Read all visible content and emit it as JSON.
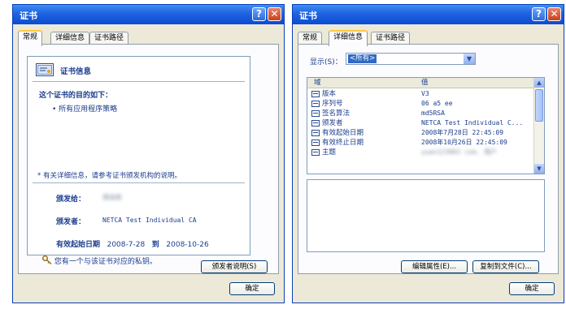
{
  "left_dialog": {
    "title": "证书",
    "help_label": "?",
    "close_label": "✕",
    "tabs": [
      {
        "label": "常规"
      },
      {
        "label": "详细信息"
      },
      {
        "label": "证书路径"
      }
    ],
    "header": {
      "title": "证书信息"
    },
    "purpose_title": "这个证书的目的如下：",
    "purpose_items": [
      "• 所有应用程序策略"
    ],
    "more_info": "* 有关详细信息，请参考证书颁发机构的说明。",
    "issued_to": {
      "label": "颁发给：",
      "value": "用加库"
    },
    "issued_by": {
      "label": "颁发者：",
      "value": "NETCA Test Individual CA"
    },
    "validity": {
      "label": "有效起始日期",
      "from": "2008-7-28",
      "to_label": "到",
      "to": "2008-10-26"
    },
    "private_key_note": "您有一个与该证书对应的私钥。",
    "issuer_statement_button": "颁发者说明(S)",
    "ok_button": "确定"
  },
  "right_dialog": {
    "title": "证书",
    "help_label": "?",
    "close_label": "✕",
    "tabs": [
      {
        "label": "常规"
      },
      {
        "label": "详细信息"
      },
      {
        "label": "证书路径"
      }
    ],
    "show": {
      "label": "显示(S)：",
      "value": "<所有>"
    },
    "columns": {
      "field": "域",
      "value": "值"
    },
    "rows": [
      {
        "field": "版本",
        "value": "V3"
      },
      {
        "field": "序列号",
        "value": "06 a5 ee"
      },
      {
        "field": "签名算法",
        "value": "md5RSA"
      },
      {
        "field": "颁发者",
        "value": "NETCA Test Individual C..."
      },
      {
        "field": "有效起始日期",
        "value": "2008年7月28日 22:45:09"
      },
      {
        "field": "有效终止日期",
        "value": "2008年10月26日 22:45:09"
      },
      {
        "field": "主题",
        "value": "yuan123903 com, 用户"
      }
    ],
    "edit_properties_button": "编辑属性(E)...",
    "copy_to_file_button": "复制到文件(C)...",
    "ok_button": "确定"
  }
}
